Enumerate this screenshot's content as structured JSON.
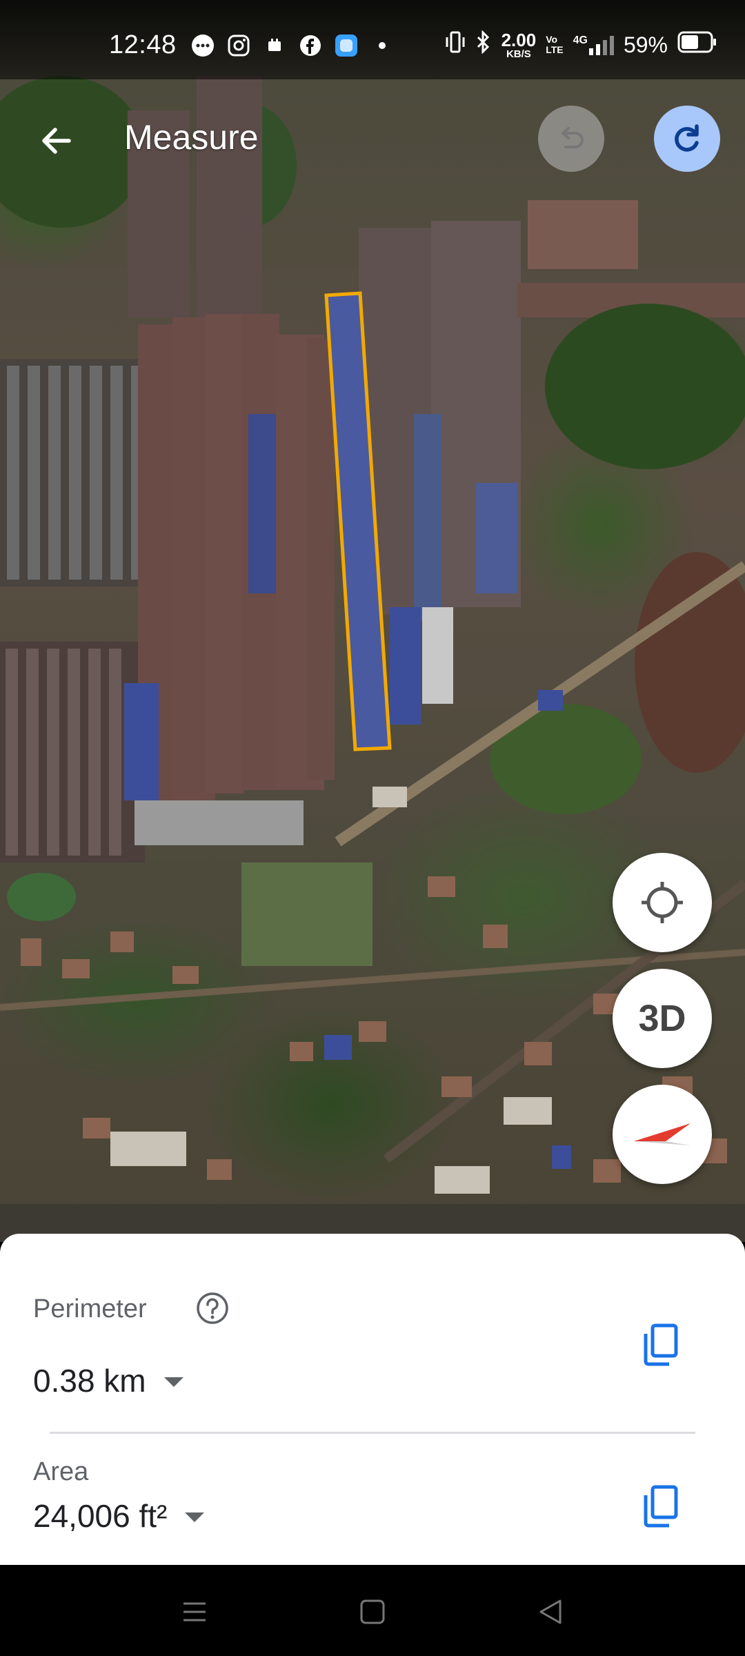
{
  "status_bar": {
    "time": "12:48",
    "notification_icons": [
      "message-icon",
      "instagram-icon",
      "notification-icon",
      "facebook-icon",
      "app-icon",
      "dot-icon"
    ],
    "net_speed_value": "2.00",
    "net_speed_unit": "KB/S",
    "volte_top": "Vo",
    "volte_bottom": "LTE",
    "network_type": "4G",
    "battery_percent": "59%",
    "battery_level": 0.59
  },
  "app_bar": {
    "title": "Measure",
    "back_icon": "arrow-back-icon",
    "undo_icon": "undo-icon",
    "redo_icon": "redo-icon"
  },
  "map_controls": {
    "location_icon": "my-location-icon",
    "view_3d_label": "3D",
    "compass_icon": "compass-icon"
  },
  "measurement": {
    "perimeter_label": "Perimeter",
    "perimeter_value": "0.38 km",
    "area_label": "Area",
    "area_value": "24,006 ft²",
    "help_icon": "help-icon",
    "copy_icon": "copy-icon"
  },
  "colors": {
    "measure_outline": "#f2a900",
    "redo_bg": "#a8c7fa",
    "accent_blue": "#1a73e8"
  },
  "nav_bar": {
    "icons": [
      "menu-icon",
      "home-icon",
      "back-icon"
    ]
  }
}
